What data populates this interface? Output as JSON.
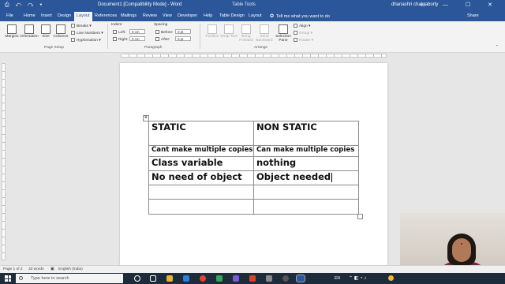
{
  "titlebar": {
    "document_title": "Document1 [Compatibility Mode] - Word",
    "contextual": "Table Tools",
    "user": "dhanashri chakraborty",
    "quick_access": "⎙ ↶ ↷ ▾",
    "window_buttons": "▭ — ☐ ✕"
  },
  "tabs": [
    "File",
    "Home",
    "Insert",
    "Design",
    "Layout",
    "References",
    "Mailings",
    "Review",
    "View",
    "Developer",
    "Help",
    "Table Design",
    "Layout"
  ],
  "active_tab": "Layout",
  "tell_me": "Tell me what you want to do",
  "share": "Share",
  "ribbon": {
    "margins": "Margins",
    "orientation": "Orientation",
    "size": "Size",
    "columns": "Columns",
    "breaks": "Breaks",
    "line_numbers": "Line Numbers",
    "hyphenation": "Hyphenation",
    "page_setup_group": "Page Setup",
    "indent_label": "Indent",
    "left_label": "Left:",
    "left_value": "0 cm",
    "right_label": "Right:",
    "right_value": "0 cm",
    "spacing_label": "Spacing",
    "before_label": "Before:",
    "before_value": "0 pt",
    "after_label": "After:",
    "after_value": "0 pt",
    "paragraph_group": "Paragraph",
    "position": "Position",
    "wrap_text": "Wrap Text",
    "bring_forward": "Bring Forward",
    "send_backward": "Send Backward",
    "selection_pane": "Selection Pane",
    "align": "Align",
    "group": "Group",
    "rotate": "Rotate",
    "arrange_group": "Arrange"
  },
  "table": {
    "rows": [
      [
        "STATIC",
        "NON STATIC"
      ],
      [
        "Cant make multiple copies",
        "Can make multiple copies"
      ],
      [
        "Class variable",
        "nothing"
      ],
      [
        "No need of object",
        "Object needed"
      ],
      [
        "",
        ""
      ],
      [
        "",
        ""
      ]
    ]
  },
  "statusbar": {
    "page": "Page 1 of 2",
    "words": "33 words",
    "language": "English (India)"
  },
  "taskbar": {
    "search_placeholder": "Type here to search",
    "lang": "EN"
  }
}
